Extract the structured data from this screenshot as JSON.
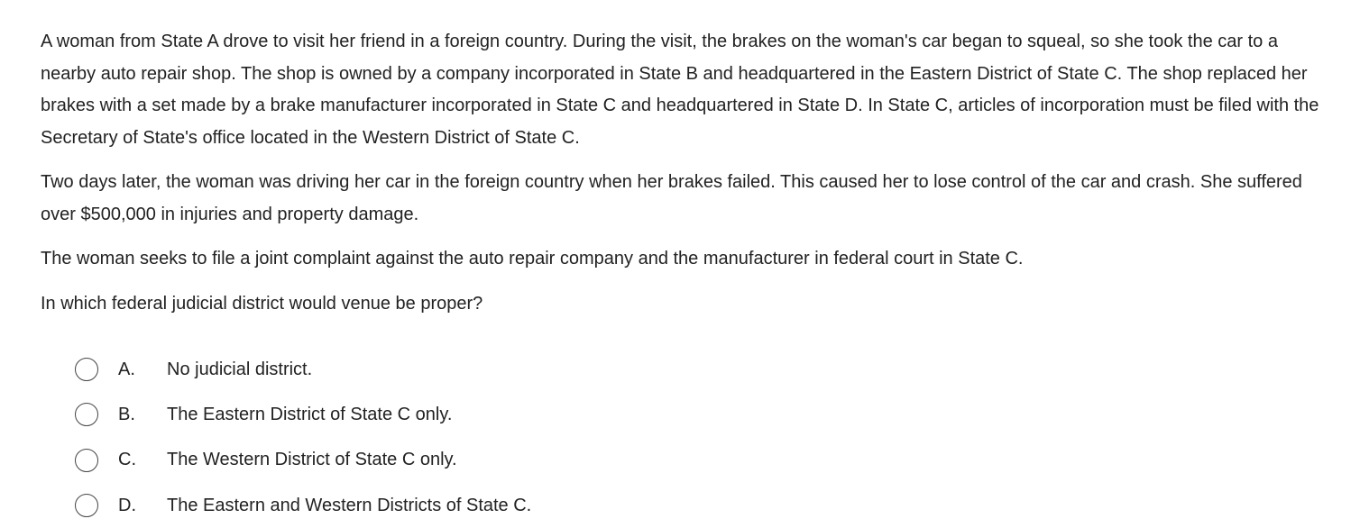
{
  "question": {
    "paragraphs": [
      "A woman from State A drove to visit her friend in a foreign country.  During the visit, the brakes on the woman's car began to squeal, so she took the car to a nearby auto repair shop.  The shop is owned by a company incorporated in State B and headquartered in the Eastern District of State C.  The shop replaced her brakes with a set made by a brake manufacturer incorporated in State C and headquartered in State D.  In State C, articles of incorporation must be filed with the Secretary of State's office located in the Western District of State C.",
      "Two days later, the woman was driving her car in the foreign country when her brakes failed.  This caused her to lose control of the car and crash.  She suffered over $500,000 in injuries and property damage.",
      "The woman seeks to file a joint complaint against the auto repair company and the manufacturer in federal court in State C.",
      "In which federal judicial district would venue be proper?"
    ]
  },
  "options": [
    {
      "letter": "A.",
      "text": "No judicial district."
    },
    {
      "letter": "B.",
      "text": "The Eastern District of State C only."
    },
    {
      "letter": "C.",
      "text": "The Western District of State C only."
    },
    {
      "letter": "D.",
      "text": "The Eastern and Western Districts of State C."
    }
  ]
}
